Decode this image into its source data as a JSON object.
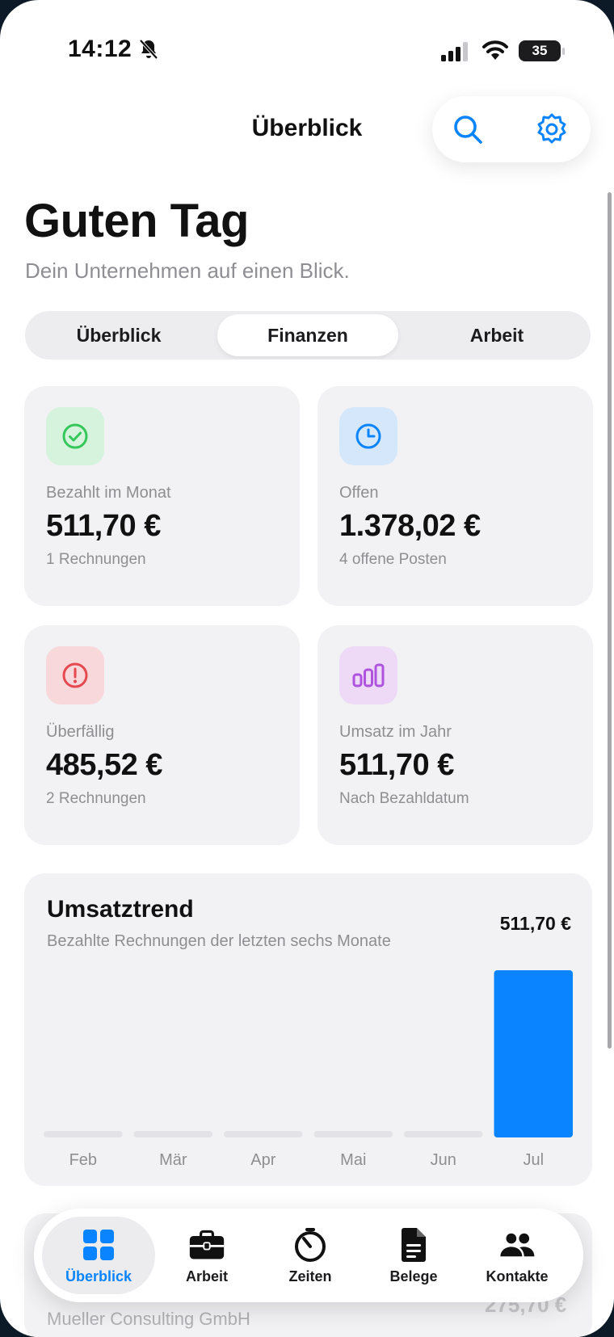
{
  "status_bar": {
    "time": "14:12",
    "battery": "35",
    "icons": [
      "bell-slash-icon",
      "cellular-signal-icon",
      "wifi-icon",
      "battery-icon"
    ]
  },
  "header": {
    "title": "Überblick",
    "actions": [
      "search-icon",
      "gear-icon"
    ]
  },
  "greeting": {
    "title": "Guten Tag",
    "subtitle": "Dein Unternehmen auf einen Blick."
  },
  "segmented": {
    "options": [
      "Überblick",
      "Finanzen",
      "Arbeit"
    ],
    "selected": "Finanzen"
  },
  "stats": [
    {
      "label": "Bezahlt im Monat",
      "value": "511,70 €",
      "sub": "1 Rechnungen",
      "icon": "checkmark-circle-icon",
      "color": "#34c759"
    },
    {
      "label": "Offen",
      "value": "1.378,02 €",
      "sub": "4 offene Posten",
      "icon": "clock-icon",
      "color": "#0a84ff"
    },
    {
      "label": "Überfällig",
      "value": "485,52 €",
      "sub": "2 Rechnungen",
      "icon": "exclamation-circle-icon",
      "color": "#e5484d"
    },
    {
      "label": "Umsatz im Jahr",
      "value": "511,70 €",
      "sub": "Nach Bezahldatum",
      "icon": "bar-chart-icon",
      "color": "#af52de"
    }
  ],
  "trend": {
    "title": "Umsatztrend",
    "subtitle": "Bezahlte Rechnungen der letzten sechs Monate",
    "total": "511,70 €"
  },
  "chart_data": {
    "type": "bar",
    "categories": [
      "Feb",
      "Mär",
      "Apr",
      "Mai",
      "Jun",
      "Jul"
    ],
    "values": [
      0,
      0,
      0,
      0,
      0,
      511.7
    ],
    "title": "Umsatztrend",
    "xlabel": "",
    "ylabel": "",
    "ylim": [
      0,
      511.7
    ],
    "grid": false,
    "bar_color": "#0a84ff",
    "empty_color": "#e3e3e7"
  },
  "list_peek": {
    "name": "Mueller Consulting GmbH",
    "amount": "275,70 €"
  },
  "tabbar": {
    "items": [
      {
        "label": "Überblick",
        "icon": "grid-icon",
        "active": true
      },
      {
        "label": "Arbeit",
        "icon": "briefcase-icon",
        "active": false
      },
      {
        "label": "Zeiten",
        "icon": "timer-icon",
        "active": false
      },
      {
        "label": "Belege",
        "icon": "document-icon",
        "active": false
      },
      {
        "label": "Kontakte",
        "icon": "people-icon",
        "active": false
      }
    ]
  },
  "colors": {
    "accent": "#0a84ff",
    "card_background": "#f2f2f4",
    "secondary_text": "#8e8e93"
  }
}
